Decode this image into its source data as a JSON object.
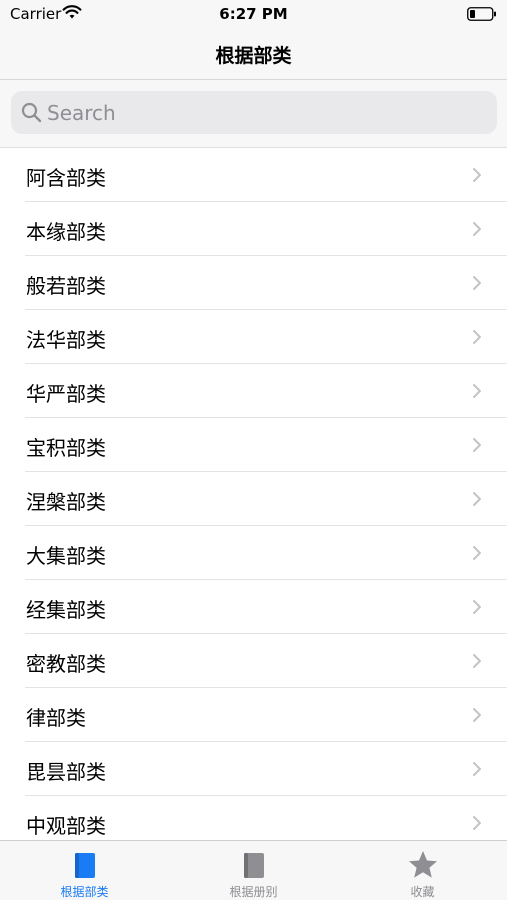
{
  "status_bar": {
    "carrier": "Carrier",
    "time": "6:27 PM"
  },
  "nav": {
    "title": "根据部类"
  },
  "search": {
    "placeholder": "Search"
  },
  "list": {
    "items": [
      {
        "label": "阿含部类"
      },
      {
        "label": "本缘部类"
      },
      {
        "label": "般若部类"
      },
      {
        "label": "法华部类"
      },
      {
        "label": "华严部类"
      },
      {
        "label": "宝积部类"
      },
      {
        "label": "涅槃部类"
      },
      {
        "label": "大集部类"
      },
      {
        "label": "经集部类"
      },
      {
        "label": "密教部类"
      },
      {
        "label": "律部类"
      },
      {
        "label": "毘昙部类"
      },
      {
        "label": "中观部类"
      }
    ]
  },
  "tabs": [
    {
      "label": "根据部类",
      "icon": "book-icon",
      "active": true
    },
    {
      "label": "根据册别",
      "icon": "book-icon",
      "active": false
    },
    {
      "label": "收藏",
      "icon": "star-icon",
      "active": false
    }
  ],
  "colors": {
    "accent": "#1a7cf5",
    "inactive": "#8e8e93",
    "bar_bg": "#f7f7f7"
  }
}
